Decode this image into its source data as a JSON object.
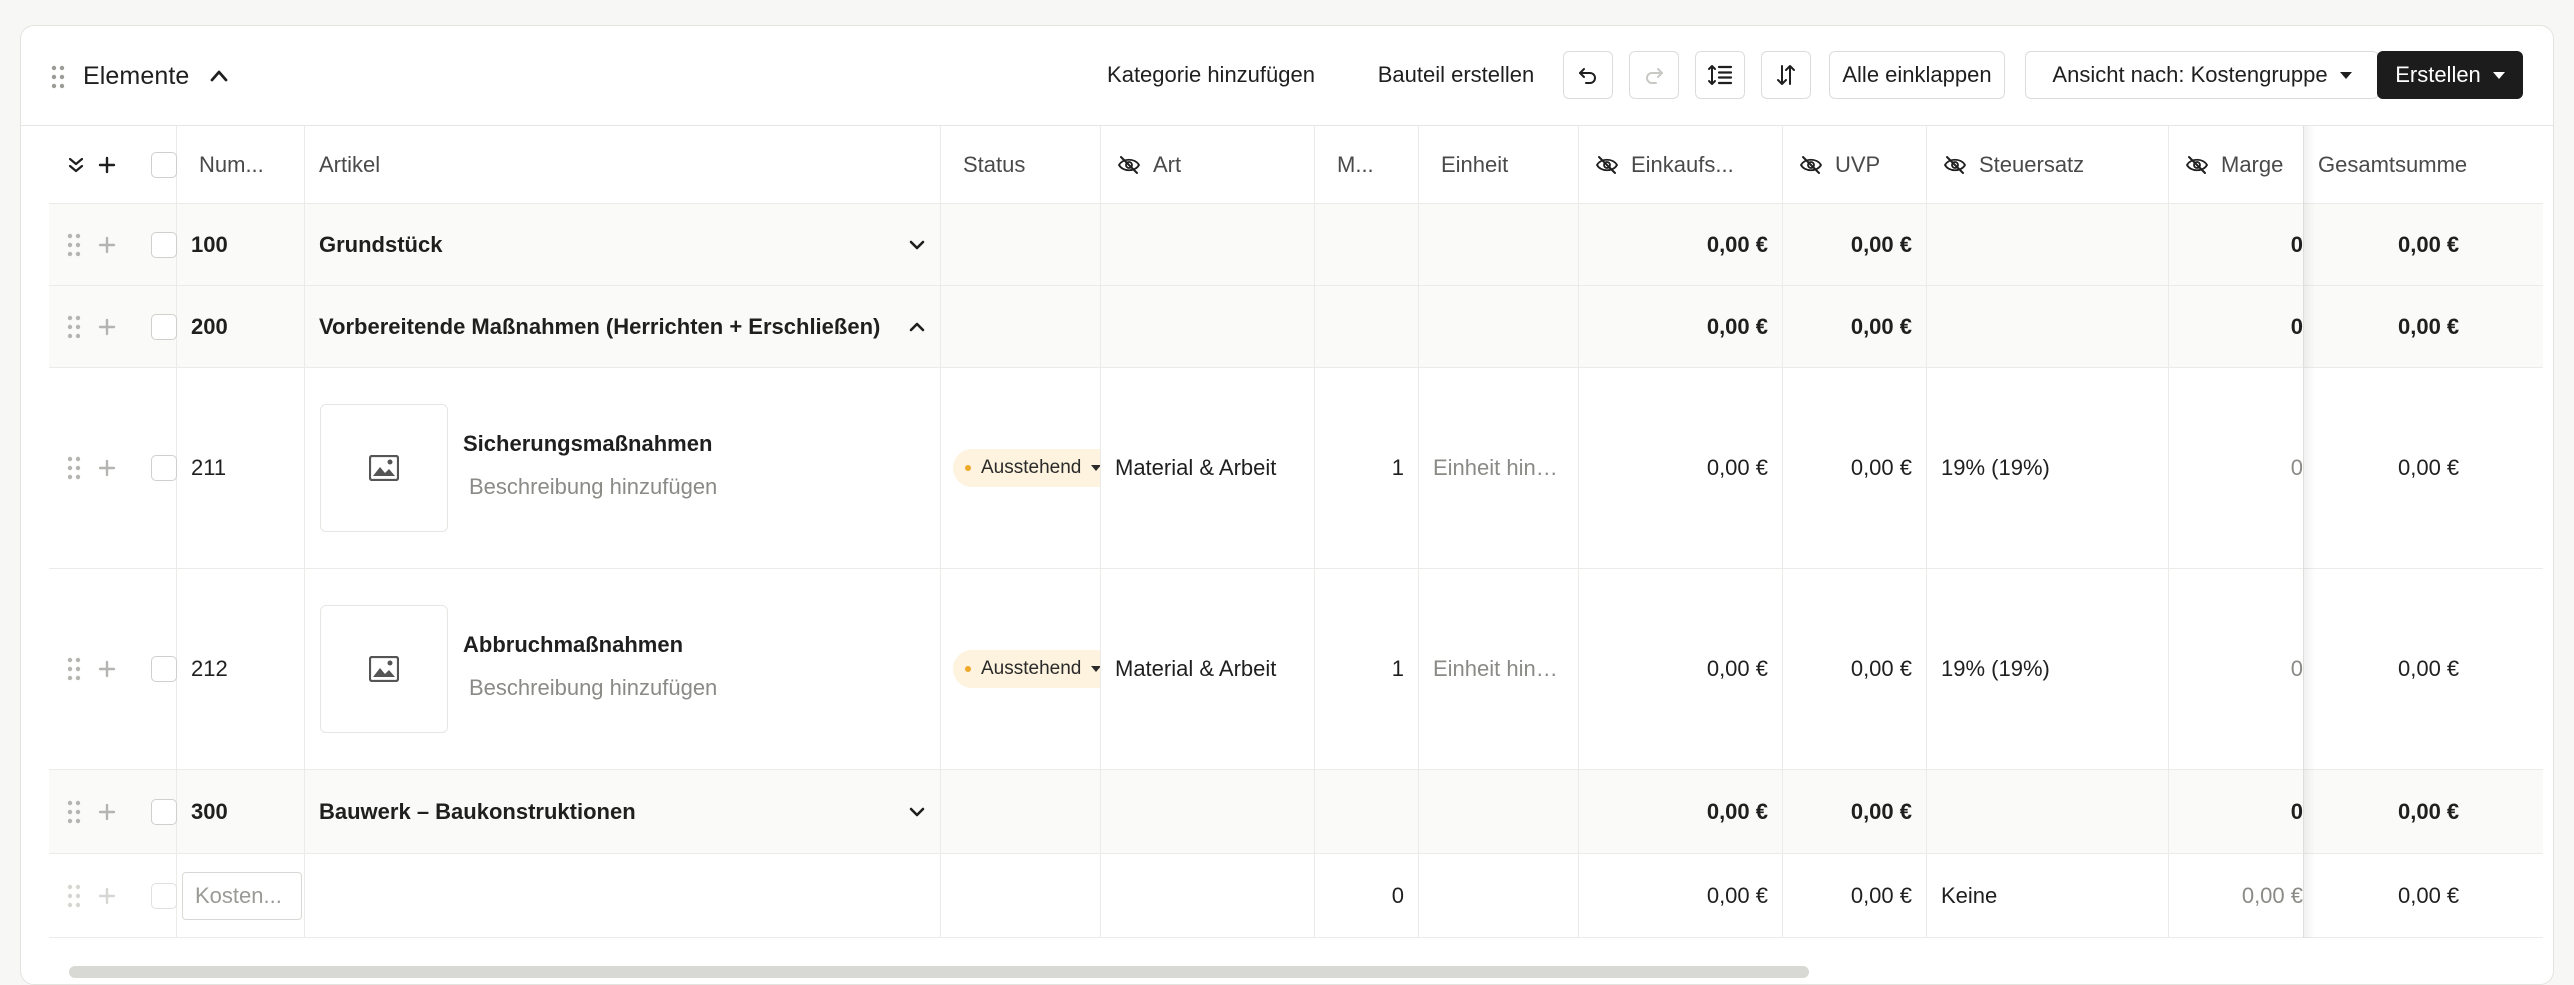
{
  "header": {
    "title": "Elemente",
    "add_category": "Kategorie hinzufügen",
    "create_component": "Bauteil erstellen",
    "collapse_all": "Alle einklappen",
    "view_by": "Ansicht nach: Kostengruppe",
    "create": "Erstellen"
  },
  "columns": {
    "number": "Num...",
    "article": "Artikel",
    "status": "Status",
    "type": "Art",
    "quantity": "M...",
    "unit": "Einheit",
    "purchase": "Einkaufs...",
    "msrp": "UVP",
    "tax": "Steuersatz",
    "margin": "Marge",
    "total": "Gesamtsumme"
  },
  "rows": [
    {
      "number": "100",
      "title": "Grundstück",
      "purchase": "0,00 €",
      "msrp": "0,00 €",
      "margin": "0",
      "total": "0,00 €"
    },
    {
      "number": "200",
      "title": "Vorbereitende Maßnahmen (Herrichten + Erschließen)",
      "purchase": "0,00 €",
      "msrp": "0,00 €",
      "margin": "0",
      "total": "0,00 €"
    },
    {
      "number": "211",
      "title": "Sicherungsmaßnahmen",
      "description": "Beschreibung hinzufügen",
      "status": "Ausstehend",
      "type": "Material & Arbeit",
      "quantity": "1",
      "unit": "Einheit hinz...",
      "purchase": "0,00 €",
      "msrp": "0,00 €",
      "tax": "19% (19%)",
      "margin": "0",
      "total": "0,00 €"
    },
    {
      "number": "212",
      "title": "Abbruchmaßnahmen",
      "description": "Beschreibung hinzufügen",
      "status": "Ausstehend",
      "type": "Material & Arbeit",
      "quantity": "1",
      "unit": "Einheit hinz...",
      "purchase": "0,00 €",
      "msrp": "0,00 €",
      "tax": "19% (19%)",
      "margin": "0",
      "total": "0,00 €"
    },
    {
      "number": "300",
      "title": "Bauwerk – Baukonstruktionen",
      "purchase": "0,00 €",
      "msrp": "0,00 €",
      "margin": "0",
      "total": "0,00 €"
    }
  ],
  "footer": {
    "number_placeholder": "Kosten...",
    "quantity": "0",
    "purchase": "0,00 €",
    "msrp": "0,00 €",
    "tax": "Keine",
    "margin": "0,00 €",
    "total": "0,00 €"
  },
  "colors": {
    "dark_button": "#1c1c1c",
    "badge_bg": "#fdf3de",
    "badge_dot": "#f0a82a"
  }
}
